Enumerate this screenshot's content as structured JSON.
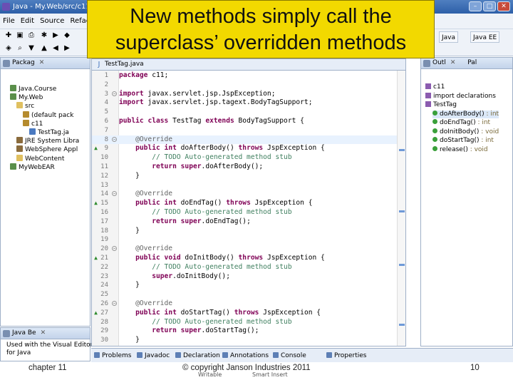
{
  "window": {
    "title": "Java - My.Web/src/c11/T"
  },
  "callout": {
    "line1": "New methods simply call the",
    "line2": "superclass’ overridden methods"
  },
  "menu": [
    "File",
    "Edit",
    "Source",
    "Refac"
  ],
  "perspectives": {
    "java": "Java",
    "javaee": "Java EE"
  },
  "left_view": {
    "tab": "Packag",
    "items": [
      {
        "label": "Java.Course",
        "depth": 1,
        "icon": "project-icon"
      },
      {
        "label": "My.Web",
        "depth": 1,
        "icon": "project-icon"
      },
      {
        "label": "src",
        "depth": 2,
        "icon": "folder-icon"
      },
      {
        "label": "(default pack",
        "depth": 3,
        "icon": "package-icon"
      },
      {
        "label": "c11",
        "depth": 3,
        "icon": "package-icon"
      },
      {
        "label": "TestTag.ja",
        "depth": 4,
        "icon": "java-file-icon"
      },
      {
        "label": "JRE System Libra",
        "depth": 2,
        "icon": "library-icon"
      },
      {
        "label": "WebSphere Appl",
        "depth": 2,
        "icon": "library-icon"
      },
      {
        "label": "WebContent",
        "depth": 2,
        "icon": "folder-icon"
      },
      {
        "label": "MyWebEAR",
        "depth": 1,
        "icon": "project-icon"
      }
    ],
    "bottom_tab": "Java Be",
    "bottom_text1": "Used with the Visual Editor",
    "bottom_text2": "for Java"
  },
  "editor": {
    "tab": "TestTag.java",
    "lines": [
      {
        "n": "1",
        "code": "package c11;"
      },
      {
        "n": "2",
        "code": ""
      },
      {
        "n": "3",
        "code": "import javax.servlet.jsp.JspException;",
        "fold": true
      },
      {
        "n": "4",
        "code": "import javax.servlet.jsp.tagext.BodyTagSupport;"
      },
      {
        "n": "5",
        "code": ""
      },
      {
        "n": "6",
        "code": "public class TestTag extends BodyTagSupport {"
      },
      {
        "n": "7",
        "code": ""
      },
      {
        "n": "8",
        "code": "    @Override",
        "fold": true,
        "current": true
      },
      {
        "n": "9",
        "code": "    public int doAfterBody() throws JspException {",
        "marker": "up"
      },
      {
        "n": "10",
        "code": "        // TODO Auto-generated method stub"
      },
      {
        "n": "11",
        "code": "        return super.doAfterBody();"
      },
      {
        "n": "12",
        "code": "    }"
      },
      {
        "n": "13",
        "code": ""
      },
      {
        "n": "14",
        "code": "    @Override",
        "fold": true
      },
      {
        "n": "15",
        "code": "    public int doEndTag() throws JspException {",
        "marker": "up"
      },
      {
        "n": "16",
        "code": "        // TODO Auto-generated method stub"
      },
      {
        "n": "17",
        "code": "        return super.doEndTag();"
      },
      {
        "n": "18",
        "code": "    }"
      },
      {
        "n": "19",
        "code": ""
      },
      {
        "n": "20",
        "code": "    @Override",
        "fold": true
      },
      {
        "n": "21",
        "code": "    public void doInitBody() throws JspException {",
        "marker": "up"
      },
      {
        "n": "22",
        "code": "        // TODO Auto-generated method stub"
      },
      {
        "n": "23",
        "code": "        super.doInitBody();"
      },
      {
        "n": "24",
        "code": "    }"
      },
      {
        "n": "25",
        "code": ""
      },
      {
        "n": "26",
        "code": "    @Override",
        "fold": true
      },
      {
        "n": "27",
        "code": "    public int doStartTag() throws JspException {",
        "marker": "up"
      },
      {
        "n": "28",
        "code": "        // TODO Auto-generated method stub"
      },
      {
        "n": "29",
        "code": "        return super.doStartTag();"
      },
      {
        "n": "30",
        "code": "    }"
      }
    ]
  },
  "outline": {
    "tab1": "Outl",
    "tab2": "Pal",
    "items": [
      {
        "label": "c11",
        "kind": "package",
        "depth": 0
      },
      {
        "label": "import declarations",
        "kind": "imports",
        "depth": 0
      },
      {
        "label": "TestTag",
        "kind": "class",
        "depth": 0
      },
      {
        "label": "doAfterBody()",
        "type": " : int",
        "kind": "method",
        "depth": 1,
        "selected": true
      },
      {
        "label": "doEndTag()",
        "type": " : int",
        "kind": "method",
        "depth": 1
      },
      {
        "label": "doInitBody()",
        "type": " : void",
        "kind": "method",
        "depth": 1
      },
      {
        "label": "doStartTag()",
        "type": " : int",
        "kind": "method",
        "depth": 1
      },
      {
        "label": "release()",
        "type": " : void",
        "kind": "method",
        "depth": 1
      }
    ]
  },
  "bottom_tabs": [
    "Problems",
    "Javadoc",
    "Declaration",
    "Annotations",
    "Console",
    "Properties"
  ],
  "status": {
    "writable": "Writable",
    "insert": "Smart Insert"
  },
  "footer": {
    "left": "chapter 11",
    "center": "© copyright Janson Industries 2011",
    "right": "10"
  }
}
